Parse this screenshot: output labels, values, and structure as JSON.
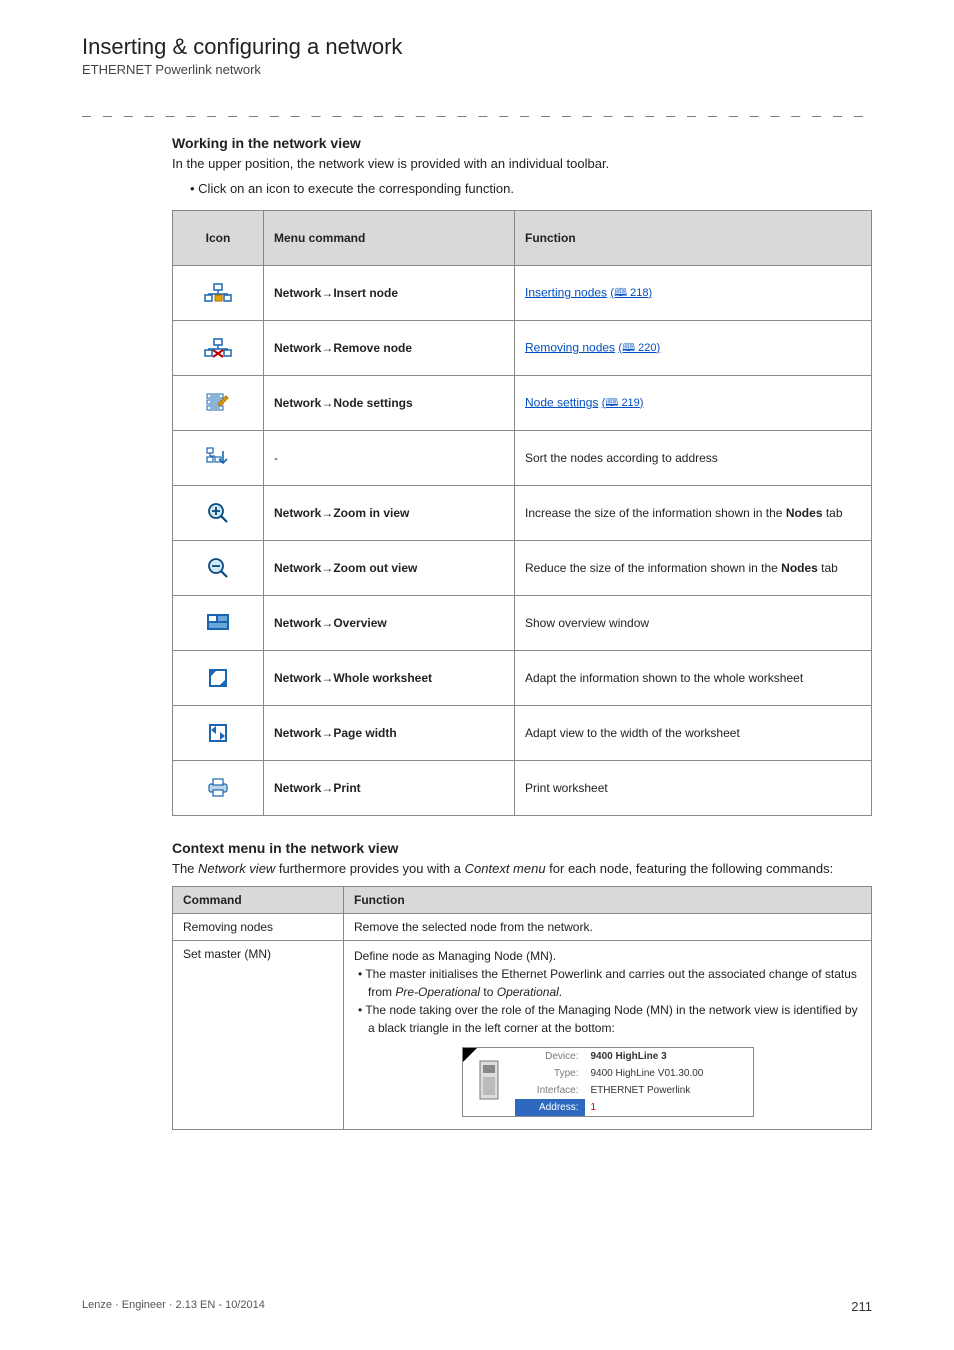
{
  "header": {
    "title": "Inserting & configuring a network",
    "subtitle": "ETHERNET Powerlink network"
  },
  "dash_line": "_ _ _ _ _ _ _ _ _ _ _ _ _ _ _ _ _ _ _ _ _ _ _ _ _ _ _ _ _ _ _ _ _ _ _ _ _ _ _ _ _ _ _ _ _ _ _ _ _ _ _ _ _ _ _ _ _ _ _ _ _ _ _ _",
  "working_section": {
    "heading": "Working in the network view",
    "intro": "In the upper position, the network view is provided with an individual toolbar.",
    "bullet": "• Click on an icon to execute the corresponding function."
  },
  "icon_table": {
    "headers": {
      "icon": "Icon",
      "menu": "Menu command",
      "func": "Function"
    },
    "rows": [
      {
        "menu": "Network→Insert node",
        "link_text": "Inserting nodes",
        "page_ref": "218"
      },
      {
        "menu": "Network→Remove node",
        "link_text": "Removing nodes",
        "page_ref": "220"
      },
      {
        "menu": "Network→Node settings",
        "link_text": "Node settings",
        "page_ref": "219"
      },
      {
        "menu": "-",
        "plain_text": "Sort the nodes according to address"
      },
      {
        "menu": "Network→Zoom in view",
        "plain_text_before": "Increase the size of the information shown in the ",
        "bold_word": "Nodes",
        "plain_text_after": " tab"
      },
      {
        "menu": "Network→Zoom out view",
        "plain_text_before": "Reduce the size of the information shown in the ",
        "bold_word": "Nodes",
        "plain_text_after": " tab"
      },
      {
        "menu": "Network→Overview",
        "plain_text": "Show overview window"
      },
      {
        "menu": "Network→Whole worksheet",
        "plain_text": "Adapt the information shown to the whole worksheet"
      },
      {
        "menu": "Network→Page width",
        "plain_text": "Adapt view to the width of the worksheet"
      },
      {
        "menu": "Network→Print",
        "plain_text": "Print worksheet"
      }
    ]
  },
  "context_section": {
    "heading": "Context menu in the network view",
    "intro_prefix": "The ",
    "intro_italic1": "Network view",
    "intro_mid": " furthermore provides you with a ",
    "intro_italic2": "Context menu",
    "intro_suffix": " for each node, featuring the following commands:"
  },
  "cmd_table": {
    "headers": {
      "command": "Command",
      "function": "Function"
    },
    "rows": [
      {
        "command": "Removing nodes",
        "function": "Remove the selected node from the network."
      }
    ],
    "master_row": {
      "command": "Set master (MN)",
      "line1": "Define node as Managing Node (MN).",
      "bullet1_prefix": "• The master initialises the Ethernet Powerlink and carries out the associated change of status from ",
      "bullet1_italic1": "Pre-Operational",
      "bullet1_mid": " to ",
      "bullet1_italic2": "Operational",
      "bullet1_suffix": ".",
      "bullet2": "• The node taking over the role of the Managing Node (MN) in the network view is identified by a black triangle in the left corner at the bottom:"
    }
  },
  "device_card": {
    "name_label": "Device:",
    "name_value": "9400 HighLine 3",
    "type_label": "Type:",
    "type_value": "9400 HighLine V01.30.00",
    "iface_label": "Interface:",
    "iface_value": "ETHERNET Powerlink",
    "addr_label": "Address:",
    "addr_value": "1"
  },
  "footer": {
    "left": "Lenze · Engineer · 2.13 EN - 10/2014",
    "page": "211"
  }
}
